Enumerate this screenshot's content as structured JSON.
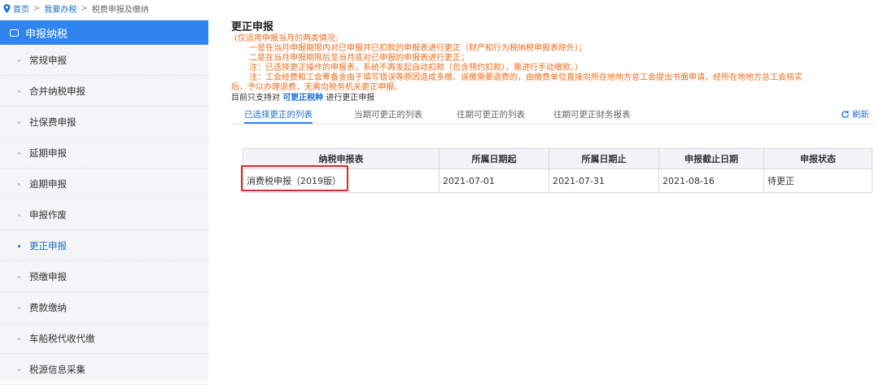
{
  "breadcrumb": {
    "home": "首页",
    "sep": ">",
    "level2": "我要办税",
    "level3": "税费申报及缴纳"
  },
  "sidebar": {
    "header": "申报纳税",
    "items": [
      {
        "label": "常规申报"
      },
      {
        "label": "合并纳税申报"
      },
      {
        "label": "社保费申报"
      },
      {
        "label": "延期申报"
      },
      {
        "label": "逾期申报"
      },
      {
        "label": "申报作废"
      },
      {
        "label": "更正申报"
      },
      {
        "label": "预缴申报"
      },
      {
        "label": "费款缴纳"
      },
      {
        "label": "车船税代收代缴"
      },
      {
        "label": "税源信息采集"
      }
    ],
    "active_index": 6
  },
  "main": {
    "title": "更正申报",
    "notes": [
      "(仅适用申报当月的两类情况:",
      "一是在当月申报期限内对已申报并已扣款的申报表进行更正（财产和行为税纳税申报表除外）；",
      "二是在当月申报期限后至当月底对已申报的申报表进行更正；",
      "注：已选择更正操作的申报表，系统不再发起自动扣款（包含预约扣款），需进行手动缴款。）",
      "注：工会经费和工会筹备金由于填写错误等原因造成多缴、误缴需要退费的，由缴费单位直接向所在地地方总工会提出书面申请，经所在地地方总工会核实",
      "后，予以办理退费，无需向税务机关更正申报。"
    ],
    "support_prefix": "目前只支持对",
    "support_link": "可更正税种",
    "support_suffix": "进行更正申报",
    "tabs": [
      "已选择更正的列表",
      "当期可更正的列表",
      "往期可更正的列表",
      "往期可更正财务报表"
    ],
    "refresh": "刷新"
  },
  "table": {
    "headers": [
      "纳税申报表",
      "所属日期起",
      "所属日期止",
      "申报截止日期",
      "申报状态"
    ],
    "rows": [
      [
        "消费税申报（2019版）",
        "2021-07-01",
        "2021-07-31",
        "2021-08-16",
        "待更正"
      ]
    ]
  },
  "colors": {
    "accent": "#2f84ef",
    "link": "#1e6fd0",
    "note": "#ef6c1a",
    "highlight_box": "#e02a2a"
  }
}
